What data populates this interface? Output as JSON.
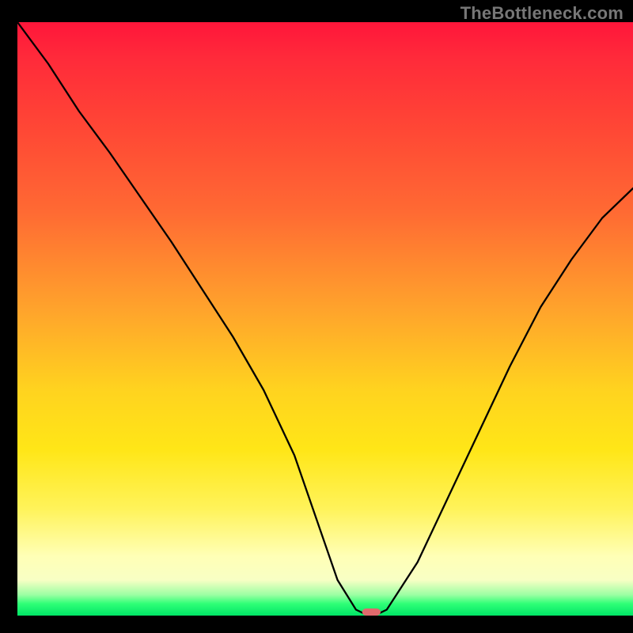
{
  "watermark": "TheBottleneck.com",
  "colors": {
    "background": "#000000",
    "gradient_top": "#ff163a",
    "gradient_mid1": "#ff6a33",
    "gradient_mid2": "#ffd31f",
    "gradient_low": "#ffffb6",
    "gradient_bottom": "#00e566",
    "curve": "#000000",
    "marker": "#e0696c"
  },
  "chart_data": {
    "type": "line",
    "title": "",
    "xlabel": "",
    "ylabel": "",
    "xlim": [
      0,
      100
    ],
    "ylim": [
      0,
      100
    ],
    "x": [
      0,
      5,
      10,
      15,
      20,
      25,
      30,
      35,
      40,
      45,
      48,
      50,
      52,
      55,
      57,
      58,
      60,
      65,
      70,
      75,
      80,
      85,
      90,
      95,
      100
    ],
    "values": [
      100,
      93,
      85,
      78,
      70.5,
      63,
      55,
      47,
      38,
      27,
      18,
      12,
      6,
      1,
      0,
      0,
      1,
      9,
      20,
      31,
      42,
      52,
      60,
      67,
      72
    ],
    "marker": {
      "x": 57.5,
      "y": 0,
      "width": 3,
      "height": 1.2
    },
    "notes": "Values are percentage of vertical axis (0 at bottom, 100 at top). Curve descends from top-left into a narrow V-shaped minimum near x≈57 then rises to the right. A small rounded pink marker sits at the minimum."
  }
}
